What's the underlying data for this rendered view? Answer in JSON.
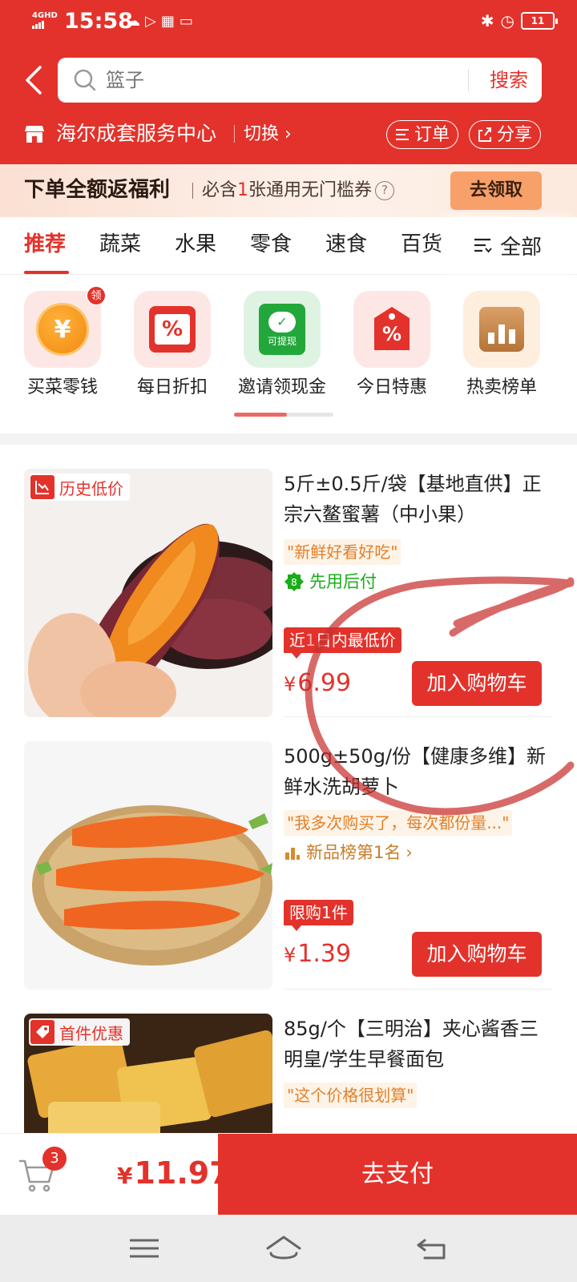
{
  "status_bar": {
    "network": "4GHD",
    "time": "15:58",
    "battery": "11"
  },
  "search": {
    "placeholder": "篮子",
    "button_label": "搜索"
  },
  "store": {
    "name": "海尔成套服务中心",
    "switch_label": "切换",
    "orders_label": "订单",
    "share_label": "分享"
  },
  "promo": {
    "title": "下单全额返福利",
    "desc_prefix": "必含",
    "desc_highlight": "1",
    "desc_suffix": "张通用无门槛券",
    "help": "?",
    "claim_label": "去领取"
  },
  "tabs": {
    "items": [
      {
        "label": "推荐",
        "active": true
      },
      {
        "label": "蔬菜",
        "active": false
      },
      {
        "label": "水果",
        "active": false
      },
      {
        "label": "零食",
        "active": false
      },
      {
        "label": "速食",
        "active": false
      },
      {
        "label": "百货",
        "active": false
      }
    ],
    "all_label": "全部"
  },
  "shortcuts": {
    "items": [
      {
        "label": "买菜零钱",
        "icon": "coin-yen-icon",
        "badge": "领",
        "icon_text": "¥"
      },
      {
        "label": "每日折扣",
        "icon": "calendar-percent-icon",
        "icon_text": "%"
      },
      {
        "label": "邀请领现金",
        "icon": "wechat-withdraw-icon",
        "icon_text": "可提现"
      },
      {
        "label": "今日特惠",
        "icon": "price-tag-percent-icon",
        "icon_text": "%"
      },
      {
        "label": "热卖榜单",
        "icon": "ranking-chart-icon"
      }
    ],
    "scroll_progress": 0.53
  },
  "products": [
    {
      "tag": "历史低价",
      "tag_icon": "price-down-chart-icon",
      "image": "sweet-potato-image",
      "title": "5斤±0.5斤/袋【基地直供】正宗六鳌蜜薯（中小果）",
      "quote": "\"新鲜好看好吃\"",
      "benefit": "先用后付",
      "benefit_icon": "pay-later-icon",
      "badge": "近",
      "badge_rest": "日内最低价",
      "currency": "¥",
      "price": "6.99",
      "add_label": "加入购物车"
    },
    {
      "image": "carrot-image",
      "title": "500g±50g/份【健康多维】新鲜水洗胡萝卜",
      "quote": "\"我多次购买了，每次都份量...\"",
      "benefit": "新品榜第1名",
      "benefit_icon": "ranking-icon",
      "badge": "限购1件",
      "currency": "¥",
      "price": "1.39",
      "add_label": "加入购物车"
    },
    {
      "tag": "首件优惠",
      "tag_icon": "discount-tag-icon",
      "image": "sandwich-bread-image",
      "title": "85g/个【三明治】夹心酱香三明皇/学生早餐面包",
      "quote": "\"这个价格很划算\""
    }
  ],
  "checkout": {
    "cart_count": "3",
    "currency": "¥",
    "total": "11.97",
    "pay_label": "去支付"
  },
  "colors": {
    "brand_red": "#e3322b",
    "promo_bg": "#fbe0d3",
    "claim_button": "#f7a06a",
    "benefit_green": "#1aad19",
    "quote_orange": "#e3802b"
  }
}
